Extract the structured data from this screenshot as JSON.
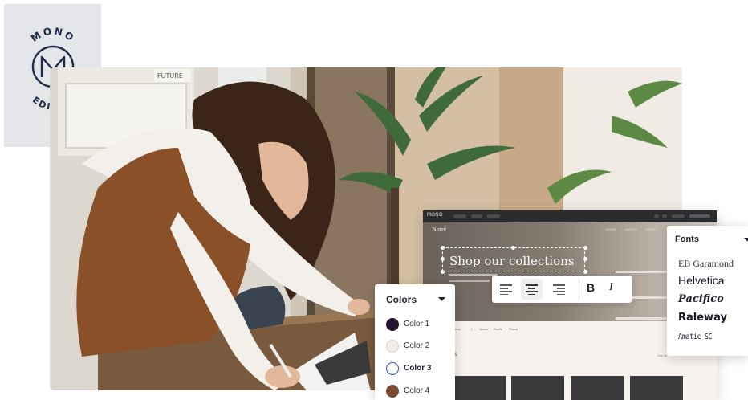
{
  "badge": {
    "top_text": "MONO",
    "bottom_text": "EDITOR",
    "background": "#e4e6ea",
    "ink": "#1e2b4a"
  },
  "photo": {
    "wall_note": "FUTURE"
  },
  "editor": {
    "logo": "MONO",
    "brand": "Noire",
    "nav": [
      "HOME",
      "ABOUT",
      "SHOP"
    ],
    "headline": "Shop our collections",
    "menu": [
      "ctions",
      "|",
      "Vases",
      "Bowls",
      "Plates"
    ],
    "section_title": "ases",
    "section_link": "See all"
  },
  "toolbar": {
    "buttons": [
      {
        "name": "align-left-icon",
        "active": false
      },
      {
        "name": "align-center-icon",
        "active": true
      },
      {
        "name": "align-right-icon",
        "active": false
      }
    ],
    "bold_label": "B",
    "italic_label": "I"
  },
  "colors_panel": {
    "title": "Colors",
    "items": [
      {
        "label": "Color 1",
        "color": "#22142e",
        "selected": false
      },
      {
        "label": "Color 2",
        "color": "#f2ece6",
        "selected": false
      },
      {
        "label": "Color 3",
        "color": "#ffffff",
        "selected": true
      },
      {
        "label": "Color 4",
        "color": "#7a4a32",
        "selected": false
      }
    ],
    "selected_ring": "#2a4bd8"
  },
  "fonts_panel": {
    "title": "Fonts",
    "items": [
      "EB Garamond",
      "Helvetica",
      "Pacifico",
      "Raleway",
      "Amatic SC"
    ]
  }
}
